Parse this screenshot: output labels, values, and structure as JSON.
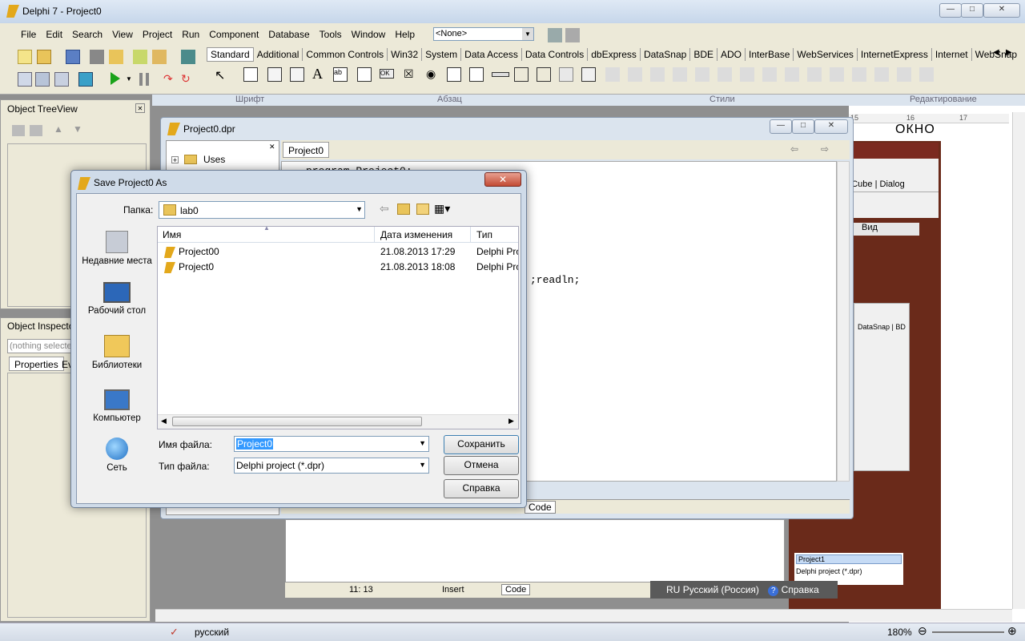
{
  "app": {
    "title": "Delphi 7 - Project0"
  },
  "menu": [
    "File",
    "Edit",
    "Search",
    "View",
    "Project",
    "Run",
    "Component",
    "Database",
    "Tools",
    "Window",
    "Help"
  ],
  "config_select": "<None>",
  "palette_tabs": [
    "Standard",
    "Additional",
    "Common Controls",
    "Win32",
    "System",
    "Data Access",
    "Data Controls",
    "dbExpress",
    "DataSnap",
    "BDE",
    "ADO",
    "InterBase",
    "WebServices",
    "InternetExpress",
    "Internet",
    "WebSnap"
  ],
  "ribbon_groups": [
    "Шрифт",
    "Абзац",
    "Стили",
    "Редактирование"
  ],
  "tree_view": {
    "title": "Object TreeView"
  },
  "inspector": {
    "title": "Object Inspector",
    "selector": "(nothing selected)",
    "tabs": [
      "Properties",
      "Events"
    ]
  },
  "project_window": {
    "title": "Project0.dpr",
    "tree_item": "Uses",
    "tab": "Project0",
    "code_lines": [
      "program Project0;",
      ";readln;"
    ],
    "bottom_tab": "Code"
  },
  "bg_window": {
    "tabs": [
      "sion Cube",
      "Dialog"
    ],
    "view_label": "Вид",
    "mini_tabs": [
      "DataSnap",
      "BD"
    ],
    "filename": "Project1",
    "filetype": "Delphi project (*.dpr)"
  },
  "word": {
    "heading": "ОКНО",
    "ruler": [
      "15",
      "16",
      "17"
    ]
  },
  "editor_status": {
    "position": "11: 13",
    "mode": "Insert",
    "tab": "Code"
  },
  "lang_bar": {
    "code": "RU",
    "language": "Русский (Россия)",
    "help": "Справка"
  },
  "status_bar": {
    "language": "русский",
    "zoom": "180%"
  },
  "dialog": {
    "title": "Save Project0 As",
    "folder_label": "Папка:",
    "folder": "lab0",
    "columns": [
      "Имя",
      "Дата изменения",
      "Тип"
    ],
    "files": [
      {
        "name": "Project00",
        "date": "21.08.2013 17:29",
        "type": "Delphi Pro"
      },
      {
        "name": "Project0",
        "date": "21.08.2013 18:08",
        "type": "Delphi Pro"
      }
    ],
    "places": [
      "Недавние места",
      "Рабочий стол",
      "Библиотеки",
      "Компьютер",
      "Сеть"
    ],
    "filename_label": "Имя файла:",
    "filename": "Project0",
    "filetype_label": "Тип файла:",
    "filetype": "Delphi project (*.dpr)",
    "save": "Сохранить",
    "cancel": "Отмена",
    "help": "Справка"
  }
}
